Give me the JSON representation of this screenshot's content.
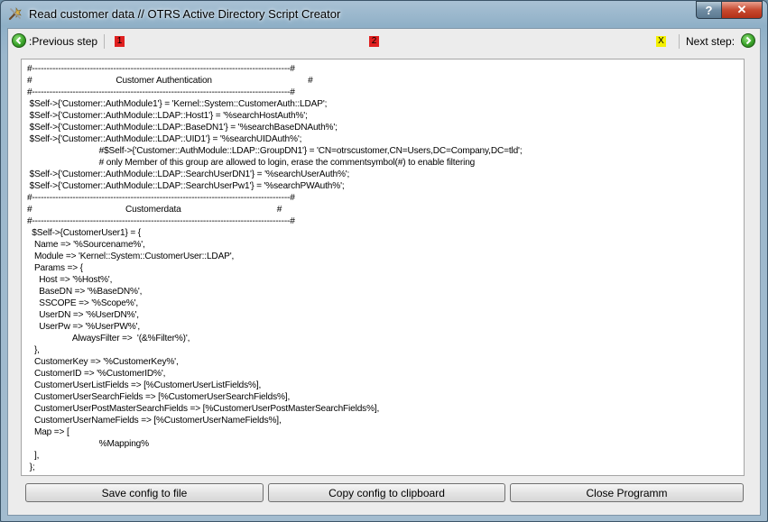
{
  "window": {
    "title": "Read customer data // OTRS Active Directory Script Creator",
    "help_label": "?",
    "close_label": "✕"
  },
  "nav": {
    "previous_label": ":Previous step",
    "next_label": "Next step:",
    "marker_1": "1",
    "marker_2": "2",
    "marker_x": "X"
  },
  "editor": {
    "text": "#-----------------------------------------------------------------------------------------#\n#                                   Customer Authentication                                        #\n#-----------------------------------------------------------------------------------------#\n $Self->{'Customer::AuthModule1'} = 'Kernel::System::CustomerAuth::LDAP';\n $Self->{'Customer::AuthModule::LDAP::Host1'} = '%searchHostAuth%';\n $Self->{'Customer::AuthModule::LDAP::BaseDN1'} = '%searchBaseDNAuth%';\n $Self->{'Customer::AuthModule::LDAP::UID1'} = '%searchUIDAuth%';\n                              #$Self->{'Customer::AuthModule::LDAP::GroupDN1'} = 'CN=otrscustomer,CN=Users,DC=Company,DC=tld';\n                              # only Member of this group are allowed to login, erase the commentsymbol(#) to enable filtering\n $Self->{'Customer::AuthModule::LDAP::SearchUserDN1'} = '%searchUserAuth%';\n $Self->{'Customer::AuthModule::LDAP::SearchUserPw1'} = '%searchPWAuth%';\n#-----------------------------------------------------------------------------------------#\n#                                       Customerdata                                        #\n#-----------------------------------------------------------------------------------------#\n  $Self->{CustomerUser1} = {\n   Name => '%Sourcename%',\n   Module => 'Kernel::System::CustomerUser::LDAP',\n   Params => {\n     Host => '%Host%',\n     BaseDN => '%BaseDN%',\n     SSCOPE => '%Scope%',\n     UserDN => '%UserDN%',\n     UserPw => '%UserPW%',\n                   AlwaysFilter =>  '(&%Filter%)',\n   },\n   CustomerKey => '%CustomerKey%',\n   CustomerID => '%CustomerID%',\n   CustomerUserListFields => [%CustomerUserListFields%],\n   CustomerUserSearchFields => [%CustomerUserSearchFields%],\n   CustomerUserPostMasterSearchFields => [%CustomerUserPostMasterSearchFields%],\n   CustomerUserNameFields => [%CustomerUserNameFields%],\n   Map => [\n                              %Mapping%\n   ],\n };"
  },
  "buttons": {
    "save": "Save config to file",
    "copy": "Copy config to clipboard",
    "close": "Close Programm"
  },
  "icons": {
    "app": "tools-icon",
    "previous": "arrow-left-circle-icon",
    "next": "arrow-right-circle-icon"
  },
  "colors": {
    "nav_icon_green": "#3aa32a",
    "marker_red": "#e02020",
    "marker_yellow": "#f4f000",
    "close_button_red": "#c74a30"
  }
}
